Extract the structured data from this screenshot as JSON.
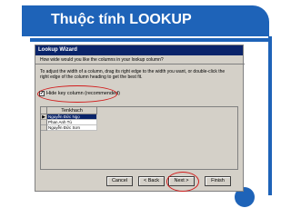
{
  "slide": {
    "title": "Thuộc tính LOOKUP"
  },
  "wizard": {
    "title": "Lookup Wizard",
    "question": "How wide would you like the columns in your lookup column?",
    "instructions_line1": "To adjust the width of a column, drag its right edge to the width you want, or double-click the",
    "instructions_line2": "right edge of the column heading to get the best fit.",
    "hide_key_label": "Hide key column (recommended)",
    "hide_key_checked": true,
    "column_header": "Tenkhach",
    "rows": [
      "Nguyễn Đức Ngọ",
      "Phan Anh Tú",
      "Nguyễn Đức Sơn"
    ],
    "buttons": {
      "cancel": "Cancel",
      "back": "< Back",
      "next": "Next >",
      "finish": "Finish"
    },
    "checkmark": "✔",
    "row_pointer": "▶"
  },
  "colors": {
    "accent": "#1e63b8",
    "highlight": "#d21c1c",
    "titlebar": "#0a246a"
  }
}
